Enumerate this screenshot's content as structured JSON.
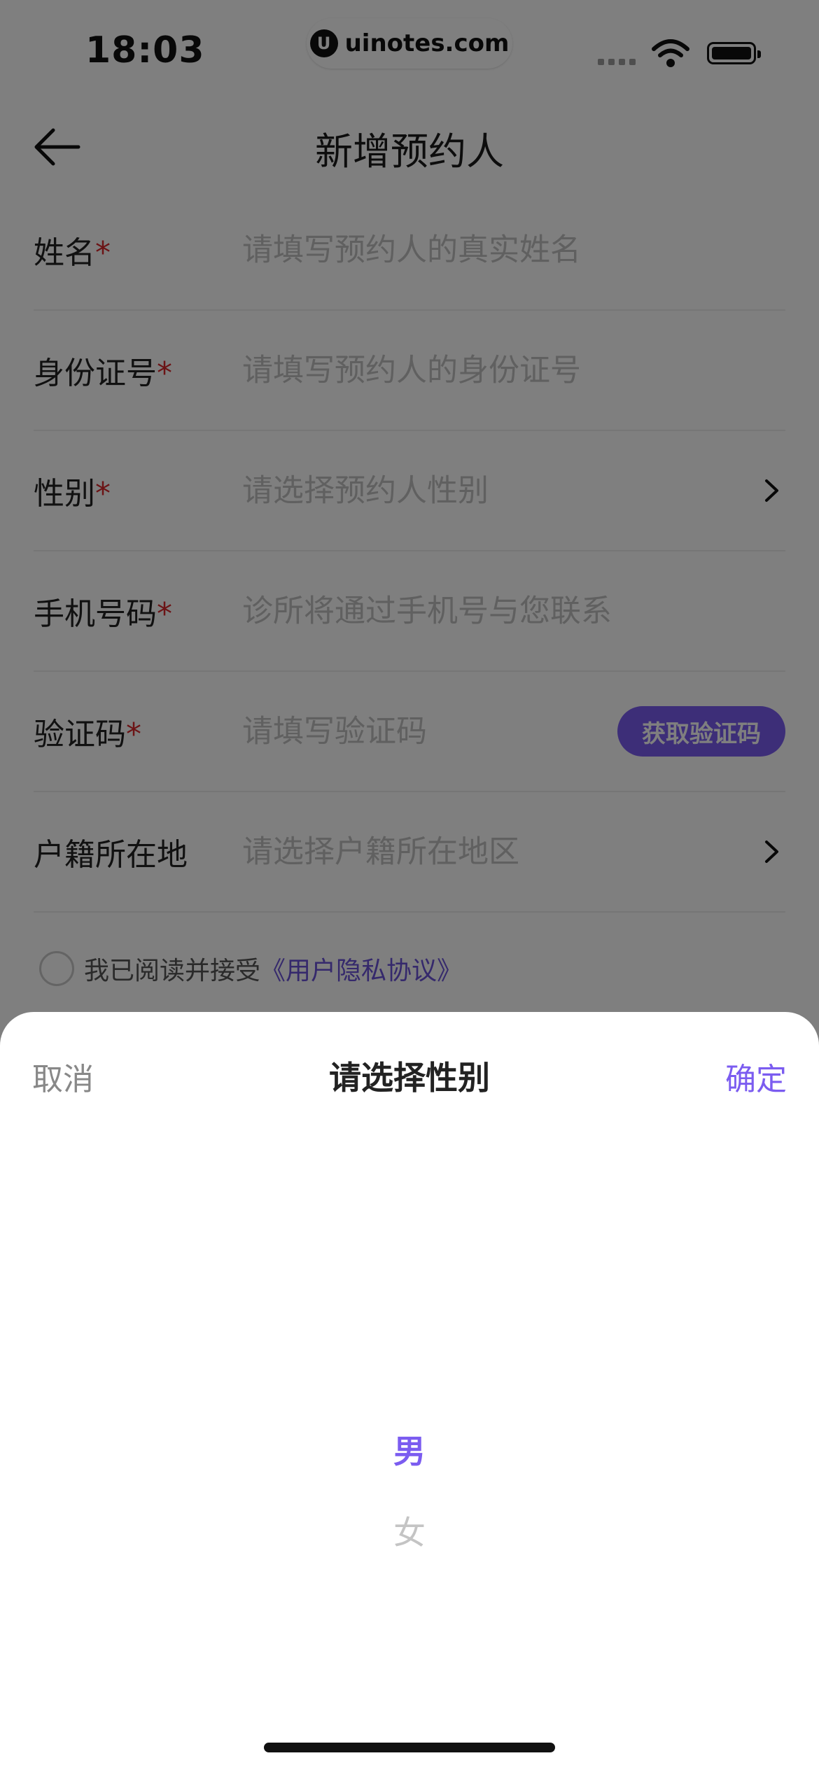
{
  "status_bar": {
    "time": "18:03",
    "watermark": "uinotes.com",
    "watermark_icon": "u-logo-icon"
  },
  "nav": {
    "title": "新增预约人",
    "back_icon": "arrow-left-icon"
  },
  "form": {
    "required_mark": "*",
    "rows": [
      {
        "label": "姓名",
        "required": true,
        "placeholder": "请填写预约人的真实姓名"
      },
      {
        "label": "身份证号",
        "required": true,
        "placeholder": "请填写预约人的身份证号"
      },
      {
        "label": "性别",
        "required": true,
        "placeholder": "请选择预约人性别"
      },
      {
        "label": "手机号码",
        "required": true,
        "placeholder": "诊所将通过手机号与您联系"
      },
      {
        "label": "验证码",
        "required": true,
        "placeholder": "请填写验证码",
        "button": "获取验证码"
      },
      {
        "label": "户籍所在地",
        "required": false,
        "placeholder": "请选择户籍所在地区"
      }
    ]
  },
  "agreement": {
    "text": "我已阅读并接受",
    "link": "《用户隐私协议》",
    "checked": false
  },
  "sheet": {
    "cancel": "取消",
    "title": "请选择性别",
    "confirm": "确定",
    "options": [
      {
        "label": "男",
        "selected": true
      },
      {
        "label": "女",
        "selected": false
      }
    ]
  },
  "colors": {
    "accent": "#7b5cf0",
    "required": "#d8262a",
    "placeholder": "#c0c0c0"
  }
}
